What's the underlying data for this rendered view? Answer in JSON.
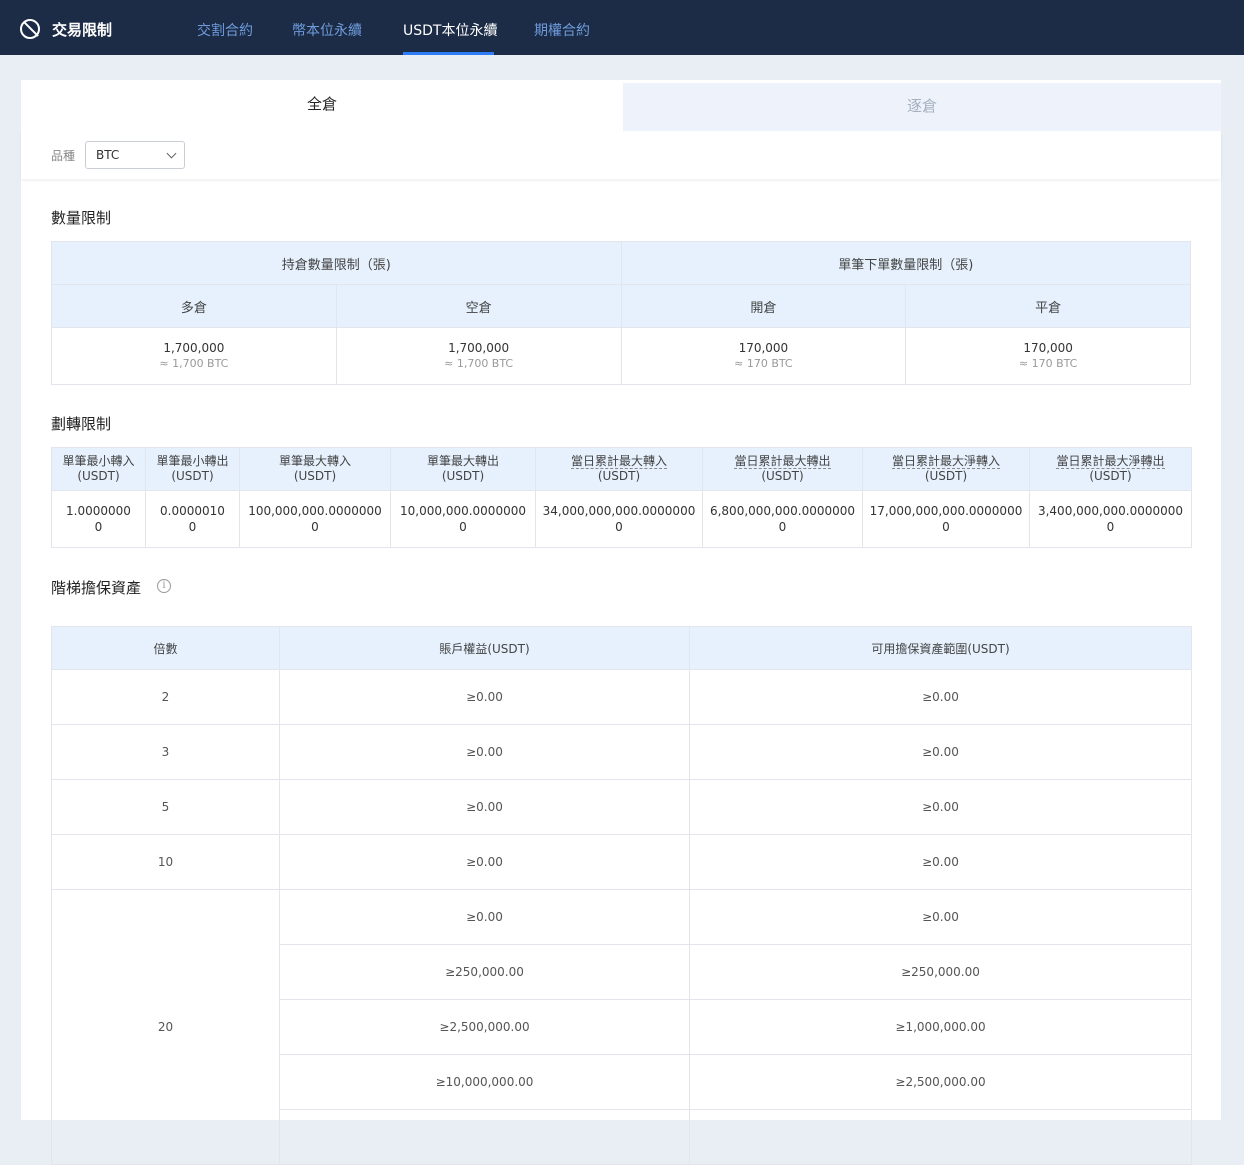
{
  "app": {
    "title": "交易限制"
  },
  "nav": {
    "tabs": [
      "交割合約",
      "幣本位永續",
      "USDT本位永續",
      "期權合約"
    ]
  },
  "mode_tabs": {
    "cross": "全倉",
    "isolated": "逐倉"
  },
  "filter": {
    "label": "品種",
    "value": "BTC"
  },
  "quantity": {
    "title": "數量限制",
    "group1": "持倉數量限制（張)",
    "group2": "單筆下單數量限制（張)",
    "cols": [
      "多倉",
      "空倉",
      "開倉",
      "平倉"
    ],
    "values": [
      "1,700,000",
      "1,700,000",
      "170,000",
      "170,000"
    ],
    "subs": [
      "≈ 1,700 BTC",
      "≈ 1,700 BTC",
      "≈ 170 BTC",
      "≈ 170 BTC"
    ]
  },
  "transfer": {
    "title": "劃轉限制",
    "headers": [
      "單筆最小轉入",
      "單筆最小轉出",
      "單筆最大轉入",
      "單筆最大轉出",
      "當日累計最大轉入",
      "當日累計最大轉出",
      "當日累計最大淨轉入",
      "當日累計最大淨轉出"
    ],
    "unit": "(USDT)",
    "values": [
      "1.0000000",
      "0.0000010",
      "100,000,000.0000000",
      "10,000,000.0000000",
      "34,000,000,000.0000000",
      "6,800,000,000.0000000",
      "17,000,000,000.0000000",
      "3,400,000,000.0000000"
    ],
    "tail": "0"
  },
  "ladder": {
    "title": "階梯擔保資產",
    "info": "i",
    "headers": [
      "倍數",
      "賬戶權益(USDT)",
      "可用擔保資產範圍(USDT)"
    ],
    "rows": [
      {
        "mult": "2",
        "equity": "≥0.00",
        "range": "≥0.00"
      },
      {
        "mult": "3",
        "equity": "≥0.00",
        "range": "≥0.00"
      },
      {
        "mult": "5",
        "equity": "≥0.00",
        "range": "≥0.00"
      },
      {
        "mult": "10",
        "equity": "≥0.00",
        "range": "≥0.00"
      }
    ],
    "group20": {
      "mult": "20",
      "rows": [
        {
          "equity": "≥0.00",
          "range": "≥0.00"
        },
        {
          "equity": "≥250,000.00",
          "range": "≥250,000.00"
        },
        {
          "equity": "≥2,500,000.00",
          "range": "≥1,000,000.00"
        },
        {
          "equity": "≥10,000,000.00",
          "range": "≥2,500,000.00"
        }
      ]
    }
  }
}
